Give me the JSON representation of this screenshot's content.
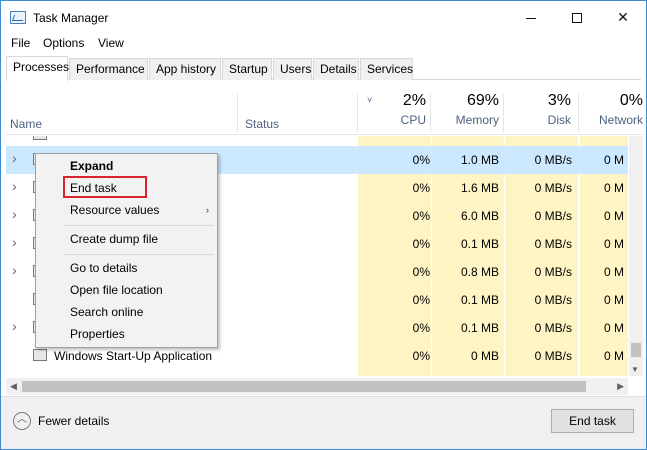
{
  "window": {
    "title": "Task Manager"
  },
  "menu": [
    "File",
    "Options",
    "View"
  ],
  "tabs": [
    "Processes",
    "Performance",
    "App history",
    "Startup",
    "Users",
    "Details",
    "Services"
  ],
  "header": {
    "name": "Name",
    "status": "Status",
    "cpu": {
      "pct": "2%",
      "label": "CPU"
    },
    "memory": {
      "pct": "69%",
      "label": "Memory"
    },
    "disk": {
      "pct": "3%",
      "label": "Disk"
    },
    "network": {
      "pct": "0%",
      "label": "Network"
    }
  },
  "rows": [
    {
      "name": "",
      "cpu": "0%",
      "memory": "1.0 MB",
      "disk": "0 MB/s",
      "network": "0 M"
    },
    {
      "name": "",
      "cpu": "0%",
      "memory": "1.6 MB",
      "disk": "0 MB/s",
      "network": "0 M"
    },
    {
      "name": "",
      "cpu": "0%",
      "memory": "6.0 MB",
      "disk": "0 MB/s",
      "network": "0 M"
    },
    {
      "name": "",
      "cpu": "0%",
      "memory": "0.1 MB",
      "disk": "0 MB/s",
      "network": "0 M"
    },
    {
      "name": "",
      "cpu": "0%",
      "memory": "0.8 MB",
      "disk": "0 MB/s",
      "network": "0 M"
    },
    {
      "name": "",
      "cpu": "0%",
      "memory": "0.1 MB",
      "disk": "0 MB/s",
      "network": "0 M"
    },
    {
      "name": "",
      "cpu": "0%",
      "memory": "0.1 MB",
      "disk": "0 MB/s",
      "network": "0 M"
    },
    {
      "name": "Windows Start-Up Application",
      "cpu": "0%",
      "memory": "0 MB",
      "disk": "0 MB/s",
      "network": "0 M"
    }
  ],
  "context_menu": {
    "expand": "Expand",
    "end_task": "End task",
    "resource_values": "Resource values",
    "create_dump": "Create dump file",
    "go_to_details": "Go to details",
    "open_location": "Open file location",
    "search_online": "Search online",
    "properties": "Properties"
  },
  "footer": {
    "fewer_details": "Fewer details",
    "end_task": "End task"
  },
  "colors": {
    "accent_border": "#3c8dd6",
    "highlight": "#fff4c4",
    "selection": "#cce8ff",
    "callout": "#d9232e"
  }
}
